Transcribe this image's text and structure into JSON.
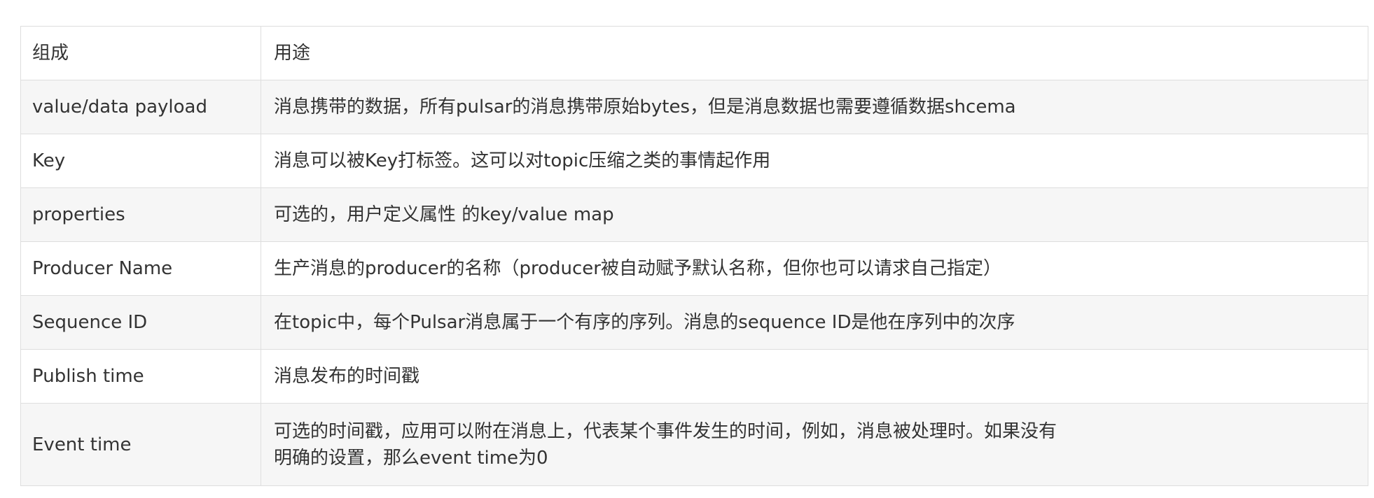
{
  "table": {
    "header": {
      "col1": "组成",
      "col2": "用途"
    },
    "rows": [
      {
        "name": "value/data payload",
        "desc": [
          "消息携带的数据，所有pulsar的消息携带原始bytes，但是消息数据也需要遵循数据shcema"
        ]
      },
      {
        "name": "Key",
        "desc": [
          "消息可以被Key打标签。这可以对topic压缩之类的事情起作用"
        ]
      },
      {
        "name": "properties",
        "desc": [
          "可选的，用户定义属性 的key/value map"
        ]
      },
      {
        "name": "Producer Name",
        "desc": [
          "生产消息的producer的名称（producer被自动赋予默认名称，但你也可以请求自己指定）"
        ]
      },
      {
        "name": "Sequence ID",
        "desc": [
          "在topic中，每个Pulsar消息属于一个有序的序列。消息的sequence ID是他在序列中的次序"
        ]
      },
      {
        "name": "Publish time",
        "desc": [
          "消息发布的时间戳"
        ]
      },
      {
        "name": "Event time",
        "desc": [
          "可选的时间戳，应用可以附在消息上，代表某个事件发生的时间，例如，消息被处理时。如果没有",
          "明确的设置，那么event time为0"
        ]
      }
    ]
  }
}
